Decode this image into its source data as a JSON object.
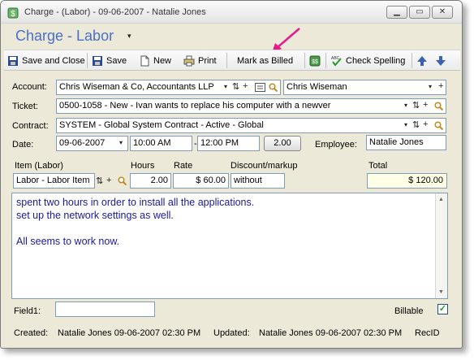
{
  "window": {
    "title": "Charge - (Labor) - 09-06-2007 - Natalie Jones",
    "min_label": "▁",
    "max_label": "▭",
    "close_label": "✕"
  },
  "heading": {
    "title": "Charge - Labor",
    "dropdown_glyph": "▾"
  },
  "toolbar": {
    "save_close": "Save and Close",
    "save": "Save",
    "new": "New",
    "print": "Print",
    "mark_billed": "Mark as Billed",
    "check_spelling": "Check Spelling"
  },
  "form": {
    "account_label": "Account:",
    "account_value": "Chris Wiseman & Co, Accountants LLP",
    "contact_value": "Chris Wiseman",
    "ticket_label": "Ticket:",
    "ticket_value": "0500-1058 - New - Ivan wants to replace his computer with a newver",
    "contract_label": "Contract:",
    "contract_value": "SYSTEM - Global System Contract - Active -  Global",
    "date_label": "Date:",
    "date_value": "09-06-2007",
    "start_time": "10:00 AM",
    "time_sep": "-",
    "end_time": "12:00 PM",
    "duration": "2.00",
    "employee_label": "Employee:",
    "employee_value": "Natalie Jones"
  },
  "item": {
    "item_header": "Item  (Labor)",
    "hours_header": "Hours",
    "rate_header": "Rate",
    "discount_header": "Discount/markup",
    "total_header": "Total",
    "item_value": "Labor - Labor Item",
    "hours_value": "2.00",
    "rate_value": "$ 60.00",
    "discount_value": "without",
    "total_value": "$ 120.00"
  },
  "notes": "spent two hours in order to install all the applications.\nset up the network settings as well.\n\nAll seems to work now.",
  "footer": {
    "field1_label": "Field1:",
    "field1_value": "",
    "billable_label": "Billable",
    "billable_checked": true,
    "created_label": "Created:",
    "created_value": "Natalie Jones 09-06-2007  02:30 PM",
    "updated_label": "Updated:",
    "updated_value": "Natalie Jones 09-06-2007  02:30 PM",
    "recid_label": "RecID"
  },
  "glyphs": {
    "dropdown": "▾",
    "plus": "+",
    "sort": "⇅",
    "check": "✓"
  },
  "colors": {
    "heading": "#4a6fc6",
    "notes_text": "#1a1a9a",
    "annotation_arrow": "#e6198f",
    "total_bg": "#ffffe6"
  }
}
